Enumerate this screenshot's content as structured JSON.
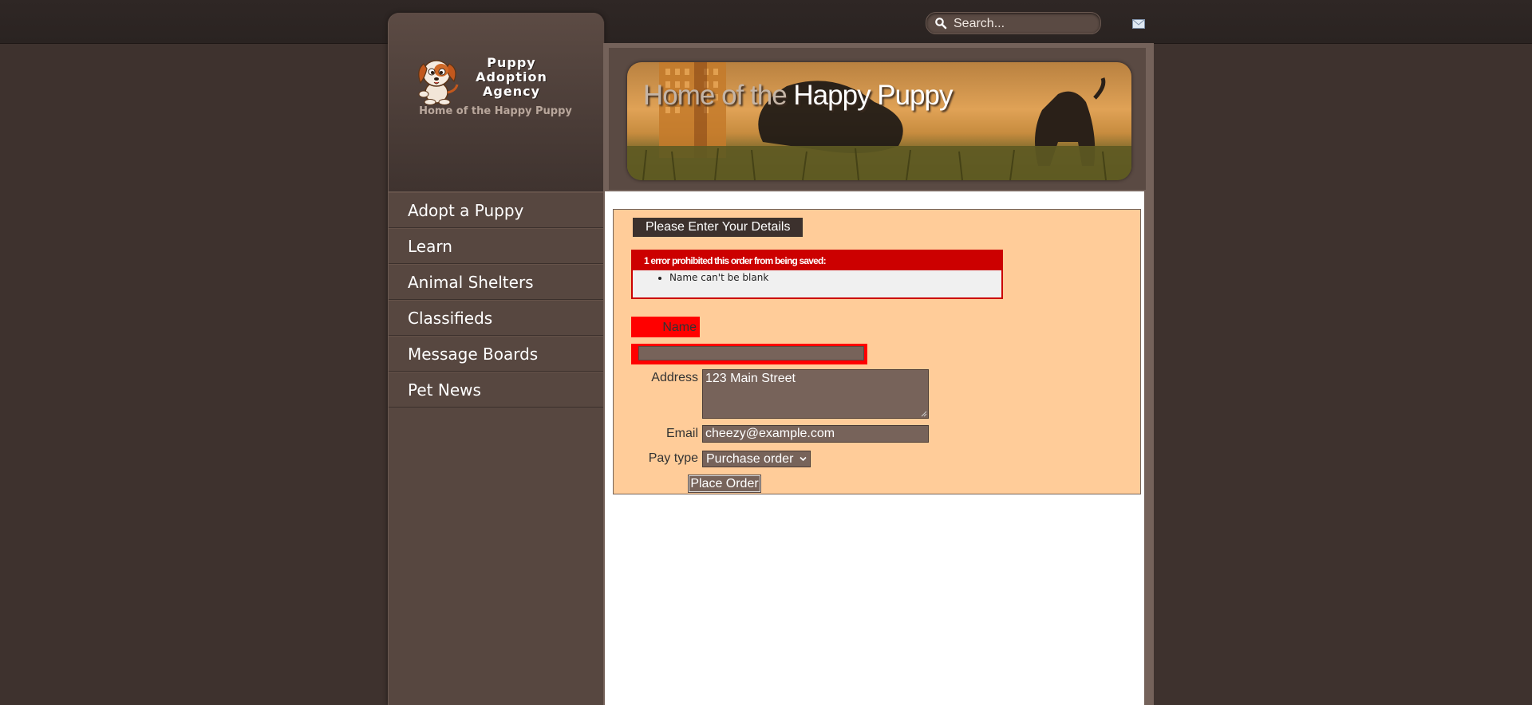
{
  "topbar": {
    "search_placeholder": "Search...",
    "search_icon": "search-icon",
    "mail_icon": "mail-icon"
  },
  "sidebar": {
    "logo_lines": [
      "Puppy",
      "Adoption",
      "Agency"
    ],
    "tagline": "Home of the Happy Puppy",
    "nav": [
      {
        "label": "Adopt a Puppy"
      },
      {
        "label": "Learn"
      },
      {
        "label": "Animal Shelters"
      },
      {
        "label": "Classifieds"
      },
      {
        "label": "Message Boards"
      },
      {
        "label": "Pet News"
      }
    ]
  },
  "banner": {
    "title_part1": "Home of the",
    "title_part2": "Happy Puppy"
  },
  "form": {
    "legend": "Please Enter Your Details",
    "error_heading": "1 error prohibited this order from being saved:",
    "errors": [
      "Name can't be blank"
    ],
    "name_label": "Name",
    "name_value": "",
    "address_label": "Address",
    "address_value": "123 Main Street",
    "email_label": "Email",
    "email_value": "cheezy@example.com",
    "pay_type_label": "Pay type",
    "pay_type_value": "Purchase order",
    "submit_label": "Place Order"
  },
  "colors": {
    "page_bg": "#3e322e",
    "sidebar_bg": "#574740",
    "form_bg": "#ffcc99",
    "error_red": "#cc0000",
    "field_error": "#ff0000",
    "input_bg": "#77635a"
  }
}
